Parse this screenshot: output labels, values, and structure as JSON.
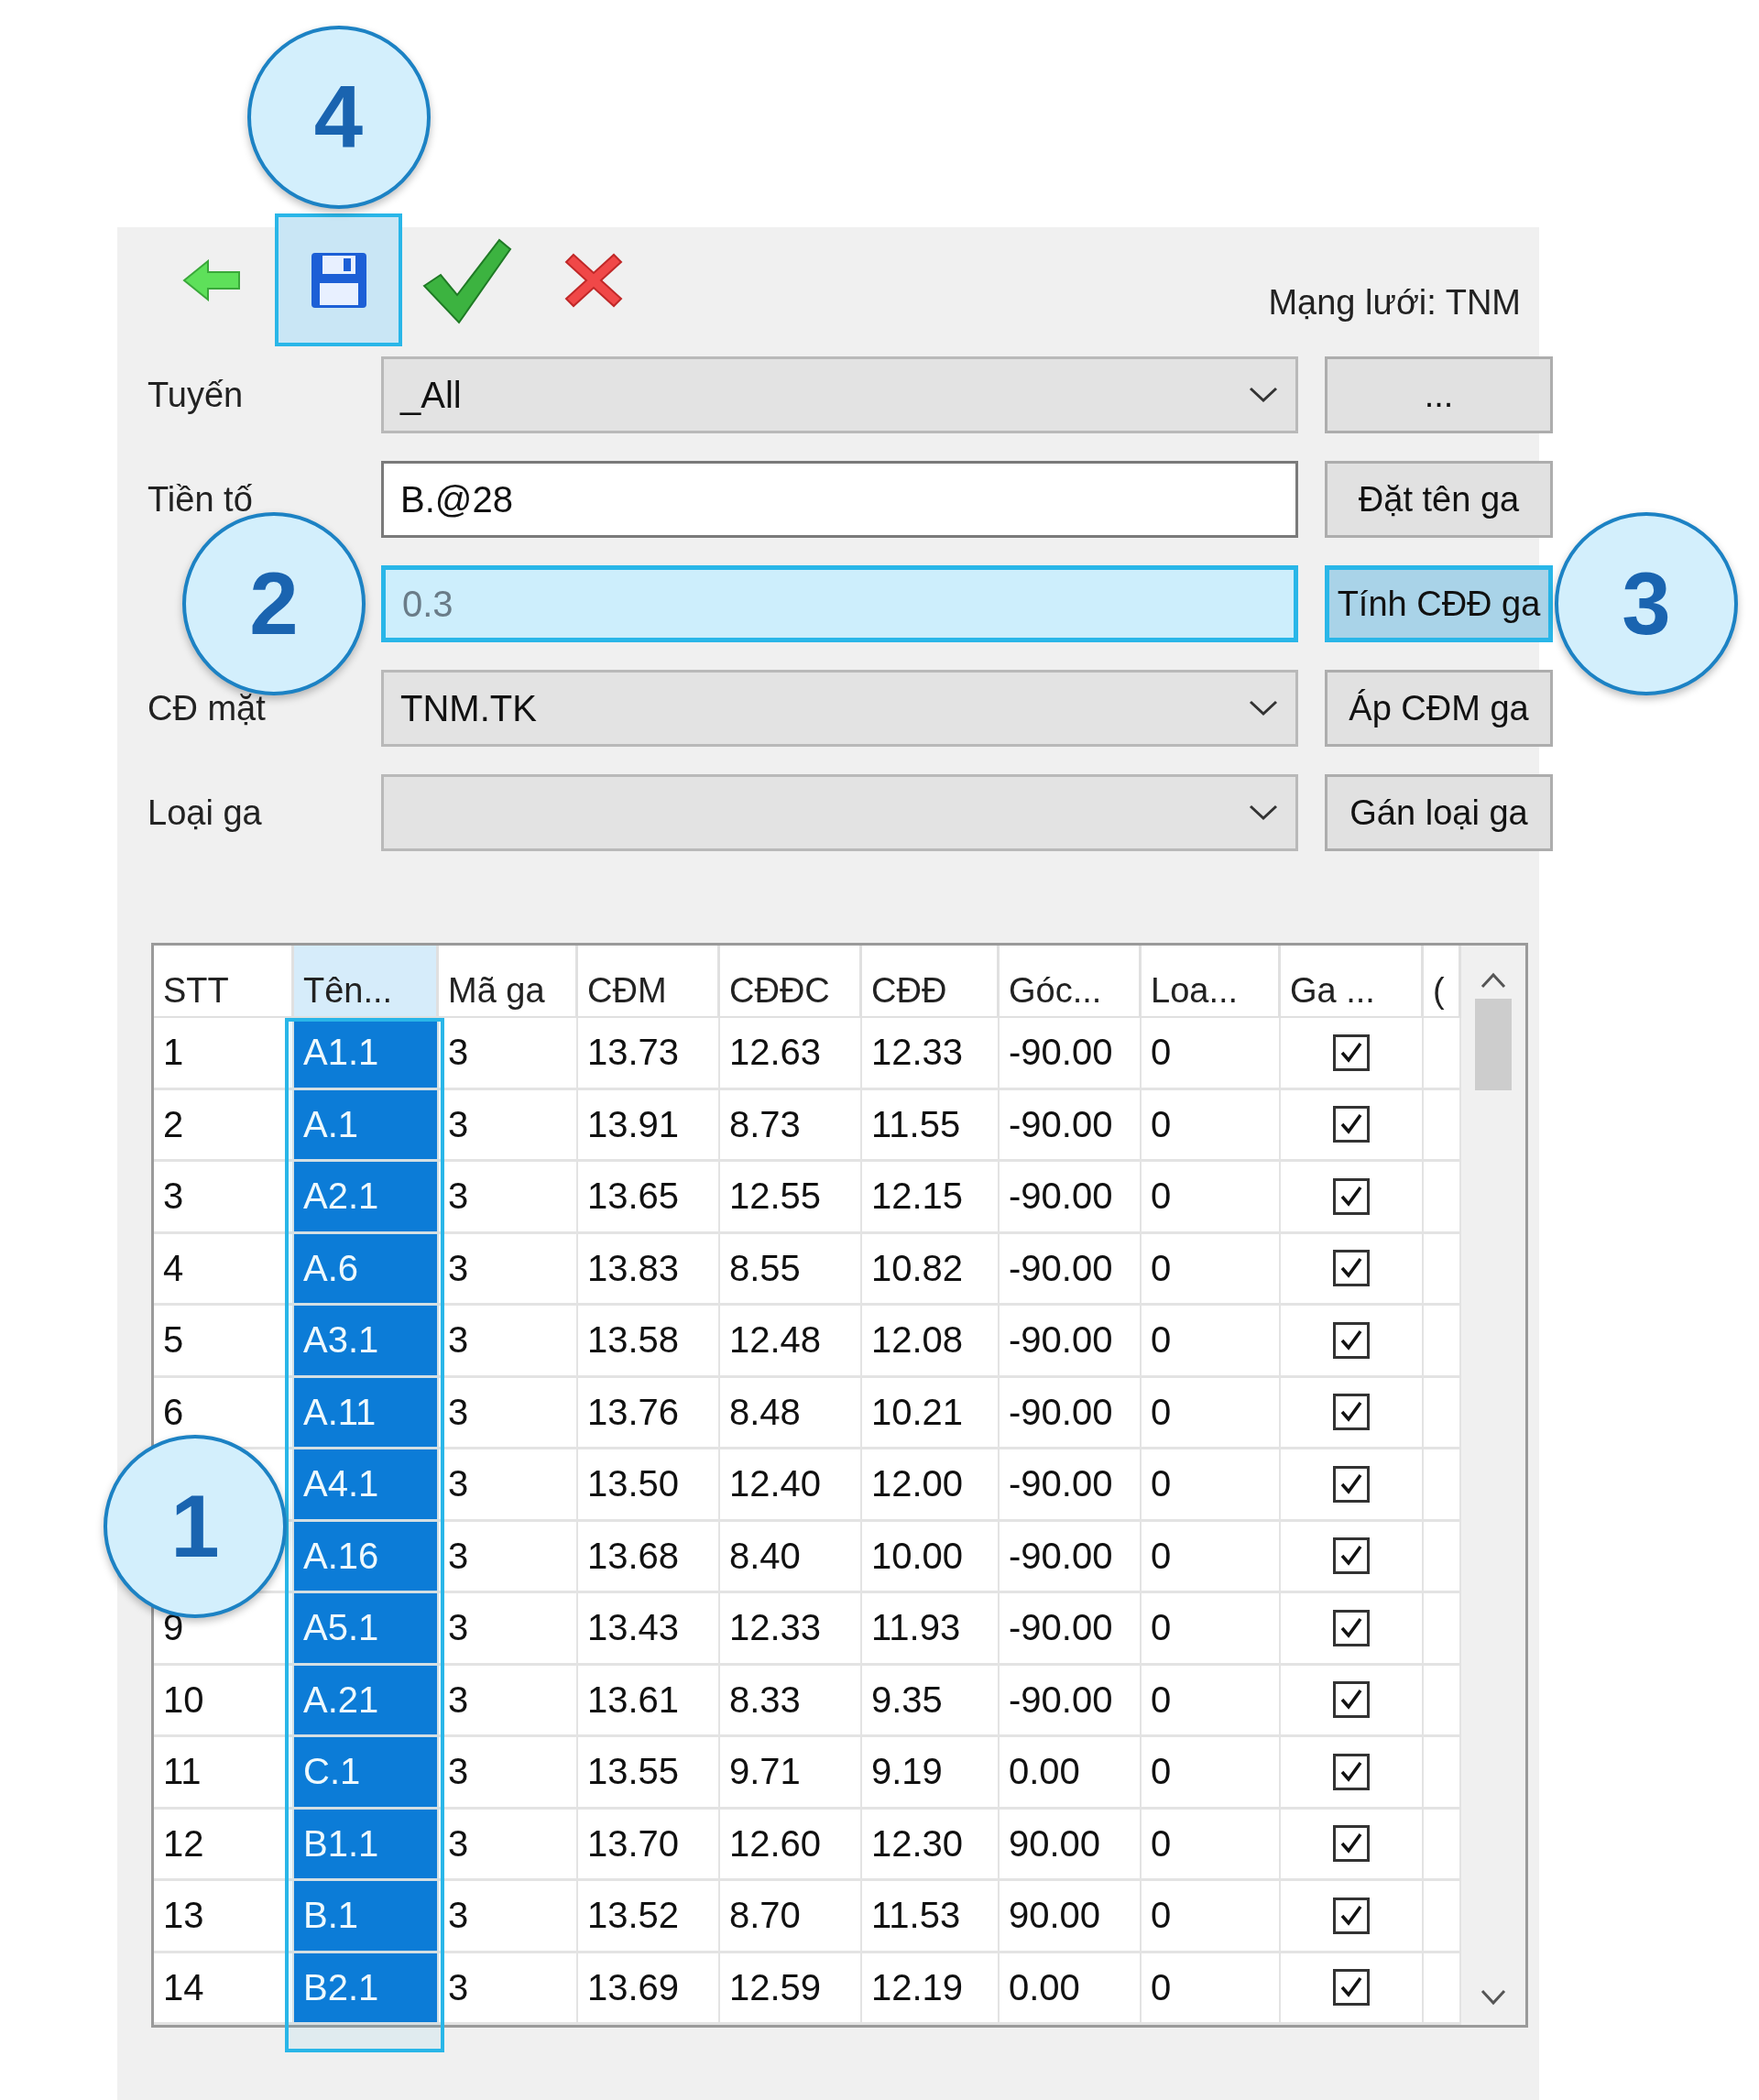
{
  "toolbar": {
    "buttons": [
      {
        "kind": "back",
        "selected": false
      },
      {
        "kind": "save",
        "selected": true,
        "callout": "4"
      },
      {
        "kind": "confirm",
        "selected": false
      },
      {
        "kind": "cancel",
        "selected": false
      }
    ],
    "network_label": "Mạng lưới: TNM"
  },
  "fields": [
    {
      "label": "Tuyến",
      "kind": "dropdown",
      "value": "_All",
      "highlighted": false,
      "button": {
        "label": "...",
        "highlighted": false
      }
    },
    {
      "label": "Tiền tố",
      "kind": "text",
      "value": "B.@28",
      "highlighted": false,
      "button": {
        "label": "Đặt tên ga",
        "highlighted": false
      }
    },
    {
      "kind": "text",
      "value": "0.3",
      "highlighted": true,
      "callout": "2",
      "button": {
        "label": "Tính CĐĐ ga",
        "highlighted": true,
        "callout": "3"
      }
    },
    {
      "label": "CĐ mặt",
      "kind": "dropdown",
      "value": "TNM.TK",
      "highlighted": false,
      "button": {
        "label": "Áp CĐM ga",
        "highlighted": false
      }
    },
    {
      "label": "Loại ga",
      "kind": "dropdown",
      "highlighted": false,
      "button": {
        "label": "Gán loại ga",
        "highlighted": false
      }
    }
  ],
  "table": {
    "columns": [
      {
        "label": "STT",
        "selected": false
      },
      {
        "label": "Tên...",
        "selected": true,
        "callout": "1"
      },
      {
        "label": "Mã ga",
        "selected": false
      },
      {
        "label": "CĐM",
        "selected": false
      },
      {
        "label": "CĐĐC",
        "selected": false
      },
      {
        "label": "CĐĐ",
        "selected": false
      },
      {
        "label": "Góc...",
        "selected": false
      },
      {
        "label": "Loa...",
        "selected": false
      },
      {
        "label": "Ga ...",
        "selected": false
      },
      {
        "label": "(",
        "selected": false
      }
    ],
    "rows": [
      {
        "cells": [
          "1",
          "A1.1",
          "3",
          "13.73",
          "12.63",
          "12.33",
          "-90.00",
          "0"
        ],
        "checked": true
      },
      {
        "cells": [
          "2",
          "A.1",
          "3",
          "13.91",
          "8.73",
          "11.55",
          "-90.00",
          "0"
        ],
        "checked": true
      },
      {
        "cells": [
          "3",
          "A2.1",
          "3",
          "13.65",
          "12.55",
          "12.15",
          "-90.00",
          "0"
        ],
        "checked": true
      },
      {
        "cells": [
          "4",
          "A.6",
          "3",
          "13.83",
          "8.55",
          "10.82",
          "-90.00",
          "0"
        ],
        "checked": true
      },
      {
        "cells": [
          "5",
          "A3.1",
          "3",
          "13.58",
          "12.48",
          "12.08",
          "-90.00",
          "0"
        ],
        "checked": true
      },
      {
        "cells": [
          "6",
          "A.11",
          "3",
          "13.76",
          "8.48",
          "10.21",
          "-90.00",
          "0"
        ],
        "checked": true
      },
      {
        "cells": [
          "",
          "A4.1",
          "3",
          "13.50",
          "12.40",
          "12.00",
          "-90.00",
          "0"
        ],
        "checked": true
      },
      {
        "cells": [
          "",
          "A.16",
          "3",
          "13.68",
          "8.40",
          "10.00",
          "-90.00",
          "0"
        ],
        "checked": true
      },
      {
        "cells": [
          "9",
          "A5.1",
          "3",
          "13.43",
          "12.33",
          "11.93",
          "-90.00",
          "0"
        ],
        "checked": true
      },
      {
        "cells": [
          "10",
          "A.21",
          "3",
          "13.61",
          "8.33",
          "9.35",
          "-90.00",
          "0"
        ],
        "checked": true
      },
      {
        "cells": [
          "11",
          "C.1",
          "3",
          "13.55",
          "9.71",
          "9.19",
          "0.00",
          "0"
        ],
        "checked": true
      },
      {
        "cells": [
          "12",
          "B1.1",
          "3",
          "13.70",
          "12.60",
          "12.30",
          "90.00",
          "0"
        ],
        "checked": true
      },
      {
        "cells": [
          "13",
          "B.1",
          "3",
          "13.52",
          "8.70",
          "11.53",
          "90.00",
          "0"
        ],
        "checked": true
      },
      {
        "cells": [
          "14",
          "B2.1",
          "3",
          "13.69",
          "12.59",
          "12.19",
          "0.00",
          "0"
        ],
        "checked": true
      }
    ]
  }
}
